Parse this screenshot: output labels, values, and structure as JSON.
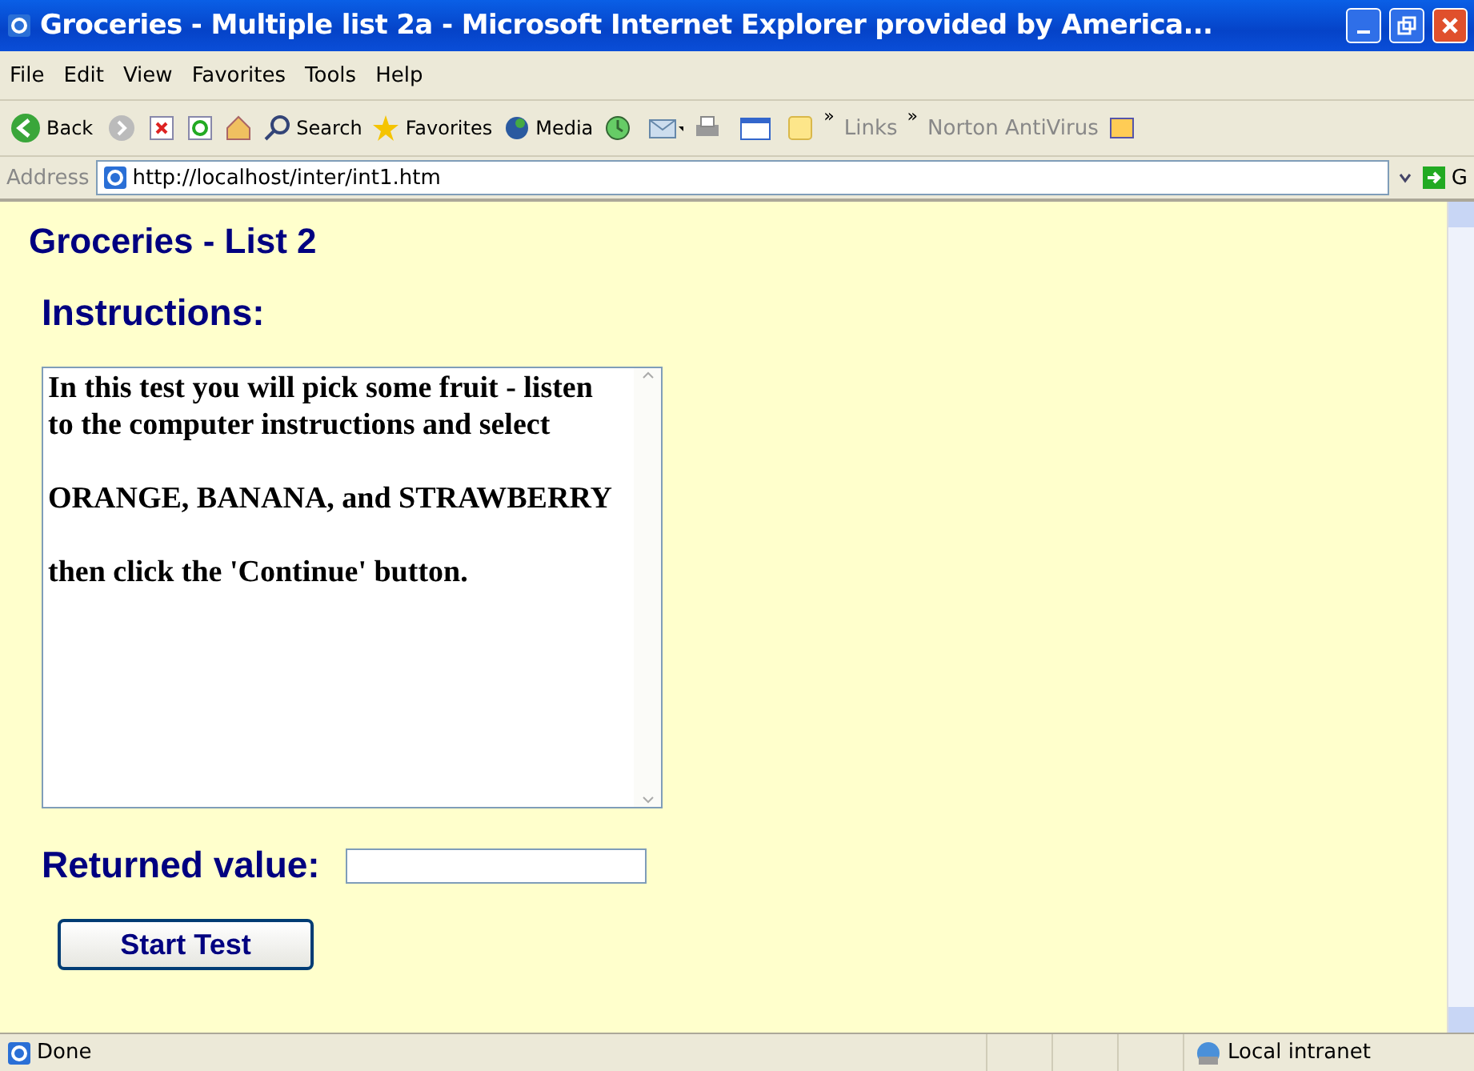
{
  "window": {
    "title": "Groceries - Multiple list 2a - Microsoft Internet Explorer provided by America..."
  },
  "menu": [
    "File",
    "Edit",
    "View",
    "Favorites",
    "Tools",
    "Help"
  ],
  "toolbar": {
    "back": "Back",
    "search": "Search",
    "favorites": "Favorites",
    "media": "Media",
    "chevron": "»",
    "links": "Links",
    "chevron_2": "»",
    "norton": "Norton AntiVirus"
  },
  "address_bar": {
    "label": "Address",
    "value": "http://localhost/inter/int1.htm",
    "go": "G"
  },
  "page": {
    "heading": "Groceries - List 2",
    "instructions_heading": "Instructions:",
    "instructions": [
      "In this test you will pick some fruit - listen to the computer instructions and select",
      "ORANGE, BANANA, and STRAWBERRY",
      "then click the 'Continue' button."
    ],
    "returned_label": "Returned value:",
    "start_button": "Start Test"
  },
  "status_bar": {
    "text": "Done",
    "zone": "Local intranet"
  }
}
